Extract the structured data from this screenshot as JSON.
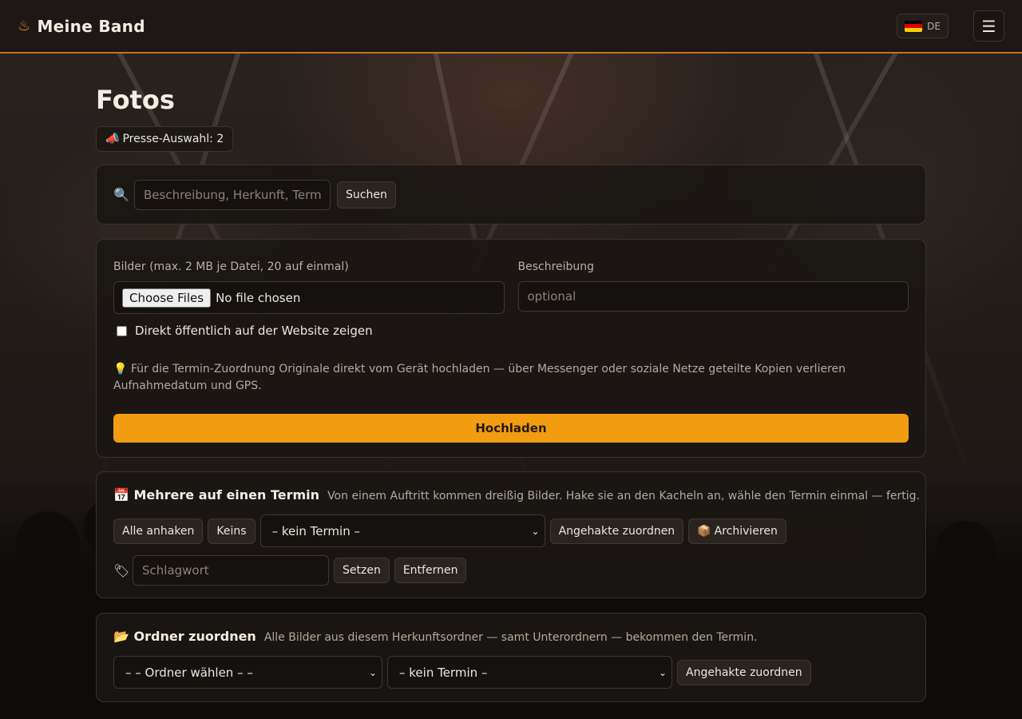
{
  "header": {
    "brand_icon": "♨",
    "brand": "Meine Band",
    "language_code": "DE",
    "menu_icon": "☰"
  },
  "page": {
    "title": "Fotos",
    "press_badge": {
      "icon": "📣",
      "label": "Presse-Auswahl: 2"
    }
  },
  "search": {
    "icon": "🔍",
    "placeholder": "Beschreibung, Herkunft, Termin",
    "value": "",
    "button": "Suchen"
  },
  "upload": {
    "images_label": "Bilder (max. 2 MB je Datei, 20 auf einmal)",
    "choose_button": "Choose Files",
    "file_status": "No file chosen",
    "description_label": "Beschreibung",
    "description_placeholder": "optional",
    "public_checkbox_label": "Direkt öffentlich auf der Website zeigen",
    "public_checked": false,
    "hint_icon": "💡",
    "hint": "Für die Termin-Zuordnung Originale direkt vom Gerät hochladen — über Messenger oder soziale Netze geteilte Kopien verlieren Aufnahmedatum und GPS.",
    "upload_button": "Hochladen"
  },
  "bulk": {
    "icon": "📅",
    "title": "Mehrere auf einen Termin",
    "description": "Von einem Auftritt kommen dreißig Bilder. Hake sie an den Kacheln an, wähle den Termin einmal — fertig.",
    "check_all": "Alle anhaken",
    "check_none": "Keins",
    "event_select": "– kein Termin –",
    "assign_button": "Angehakte zuordnen",
    "archive_icon": "📦",
    "archive_button": "Archivieren",
    "tag_icon": "🏷",
    "tag_placeholder": "Schlagwort",
    "set_button": "Setzen",
    "remove_button": "Entfernen"
  },
  "folder": {
    "icon": "📂",
    "title": "Ordner zuordnen",
    "description": "Alle Bilder aus diesem Herkunftsordner — samt Unterordnern — bekommen den Termin.",
    "folder_select": "– – Ordner wählen – –",
    "event_select": "– kein Termin –",
    "assign_button": "Angehakte zuordnen"
  },
  "colors": {
    "accent": "#f29c12",
    "header_border": "#c9701f",
    "background": "#1a1512",
    "card": "#1b1613"
  }
}
